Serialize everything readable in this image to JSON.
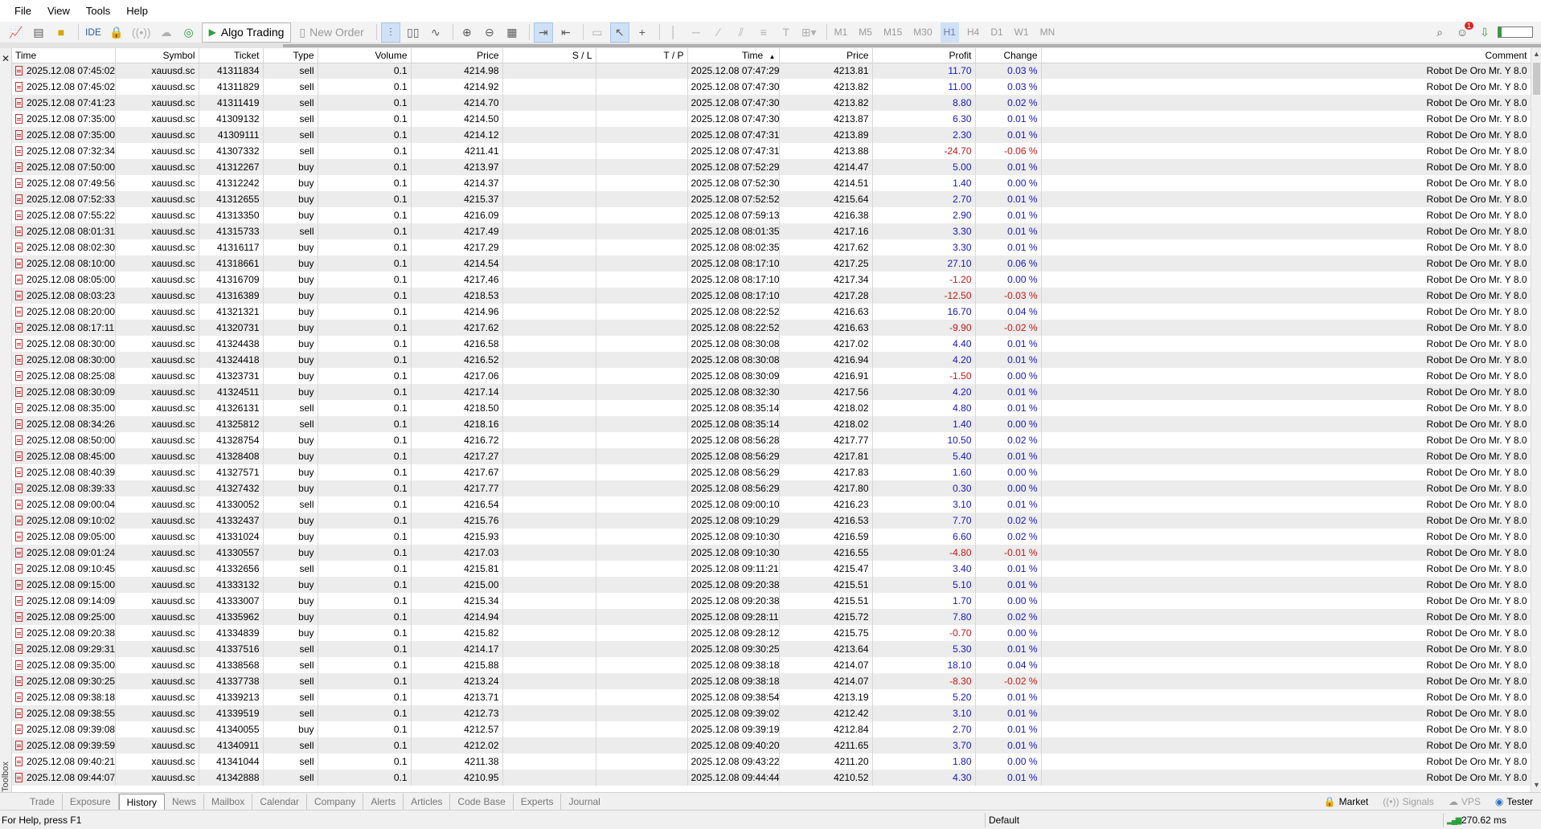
{
  "menu": [
    "File",
    "View",
    "Tools",
    "Help"
  ],
  "toolbar": {
    "ide_label": "IDE",
    "algo_label": "Algo Trading",
    "new_order_label": "New Order",
    "timeframes": [
      "M1",
      "M5",
      "M15",
      "M30",
      "H1",
      "H4",
      "D1",
      "W1",
      "MN"
    ],
    "active_timeframe": "H1",
    "notification_count": "1"
  },
  "table": {
    "columns": [
      "Time",
      "Symbol",
      "Ticket",
      "Type",
      "Volume",
      "Price",
      "S / L",
      "T / P",
      "Time",
      "Price",
      "Profit",
      "Change",
      "Comment"
    ],
    "sort_indicator": "▲",
    "rows": [
      [
        "2025.12.08 07:45:02",
        "xauusd.sc",
        "41311834",
        "sell",
        "0.1",
        "4214.98",
        "",
        "",
        "2025.12.08 07:47:29",
        "4213.81",
        "11.70",
        "0.03 %",
        "Robot De Oro Mr. Y 8.0"
      ],
      [
        "2025.12.08 07:45:02",
        "xauusd.sc",
        "41311829",
        "sell",
        "0.1",
        "4214.92",
        "",
        "",
        "2025.12.08 07:47:30",
        "4213.82",
        "11.00",
        "0.03 %",
        "Robot De Oro Mr. Y 8.0"
      ],
      [
        "2025.12.08 07:41:23",
        "xauusd.sc",
        "41311419",
        "sell",
        "0.1",
        "4214.70",
        "",
        "",
        "2025.12.08 07:47:30",
        "4213.82",
        "8.80",
        "0.02 %",
        "Robot De Oro Mr. Y 8.0"
      ],
      [
        "2025.12.08 07:35:00",
        "xauusd.sc",
        "41309132",
        "sell",
        "0.1",
        "4214.50",
        "",
        "",
        "2025.12.08 07:47:30",
        "4213.87",
        "6.30",
        "0.01 %",
        "Robot De Oro Mr. Y 8.0"
      ],
      [
        "2025.12.08 07:35:00",
        "xauusd.sc",
        "41309111",
        "sell",
        "0.1",
        "4214.12",
        "",
        "",
        "2025.12.08 07:47:31",
        "4213.89",
        "2.30",
        "0.01 %",
        "Robot De Oro Mr. Y 8.0"
      ],
      [
        "2025.12.08 07:32:34",
        "xauusd.sc",
        "41307332",
        "sell",
        "0.1",
        "4211.41",
        "",
        "",
        "2025.12.08 07:47:31",
        "4213.88",
        "-24.70",
        "-0.06 %",
        "Robot De Oro Mr. Y 8.0"
      ],
      [
        "2025.12.08 07:50:00",
        "xauusd.sc",
        "41312267",
        "buy",
        "0.1",
        "4213.97",
        "",
        "",
        "2025.12.08 07:52:29",
        "4214.47",
        "5.00",
        "0.01 %",
        "Robot De Oro Mr. Y 8.0"
      ],
      [
        "2025.12.08 07:49:56",
        "xauusd.sc",
        "41312242",
        "buy",
        "0.1",
        "4214.37",
        "",
        "",
        "2025.12.08 07:52:30",
        "4214.51",
        "1.40",
        "0.00 %",
        "Robot De Oro Mr. Y 8.0"
      ],
      [
        "2025.12.08 07:52:33",
        "xauusd.sc",
        "41312655",
        "buy",
        "0.1",
        "4215.37",
        "",
        "",
        "2025.12.08 07:52:52",
        "4215.64",
        "2.70",
        "0.01 %",
        "Robot De Oro Mr. Y 8.0"
      ],
      [
        "2025.12.08 07:55:22",
        "xauusd.sc",
        "41313350",
        "buy",
        "0.1",
        "4216.09",
        "",
        "",
        "2025.12.08 07:59:13",
        "4216.38",
        "2.90",
        "0.01 %",
        "Robot De Oro Mr. Y 8.0"
      ],
      [
        "2025.12.08 08:01:31",
        "xauusd.sc",
        "41315733",
        "sell",
        "0.1",
        "4217.49",
        "",
        "",
        "2025.12.08 08:01:35",
        "4217.16",
        "3.30",
        "0.01 %",
        "Robot De Oro Mr. Y 8.0"
      ],
      [
        "2025.12.08 08:02:30",
        "xauusd.sc",
        "41316117",
        "buy",
        "0.1",
        "4217.29",
        "",
        "",
        "2025.12.08 08:02:35",
        "4217.62",
        "3.30",
        "0.01 %",
        "Robot De Oro Mr. Y 8.0"
      ],
      [
        "2025.12.08 08:10:00",
        "xauusd.sc",
        "41318661",
        "buy",
        "0.1",
        "4214.54",
        "",
        "",
        "2025.12.08 08:17:10",
        "4217.25",
        "27.10",
        "0.06 %",
        "Robot De Oro Mr. Y 8.0"
      ],
      [
        "2025.12.08 08:05:00",
        "xauusd.sc",
        "41316709",
        "buy",
        "0.1",
        "4217.46",
        "",
        "",
        "2025.12.08 08:17:10",
        "4217.34",
        "-1.20",
        "0.00 %",
        "Robot De Oro Mr. Y 8.0"
      ],
      [
        "2025.12.08 08:03:23",
        "xauusd.sc",
        "41316389",
        "buy",
        "0.1",
        "4218.53",
        "",
        "",
        "2025.12.08 08:17:10",
        "4217.28",
        "-12.50",
        "-0.03 %",
        "Robot De Oro Mr. Y 8.0"
      ],
      [
        "2025.12.08 08:20:00",
        "xauusd.sc",
        "41321321",
        "buy",
        "0.1",
        "4214.96",
        "",
        "",
        "2025.12.08 08:22:52",
        "4216.63",
        "16.70",
        "0.04 %",
        "Robot De Oro Mr. Y 8.0"
      ],
      [
        "2025.12.08 08:17:11",
        "xauusd.sc",
        "41320731",
        "buy",
        "0.1",
        "4217.62",
        "",
        "",
        "2025.12.08 08:22:52",
        "4216.63",
        "-9.90",
        "-0.02 %",
        "Robot De Oro Mr. Y 8.0"
      ],
      [
        "2025.12.08 08:30:00",
        "xauusd.sc",
        "41324438",
        "buy",
        "0.1",
        "4216.58",
        "",
        "",
        "2025.12.08 08:30:08",
        "4217.02",
        "4.40",
        "0.01 %",
        "Robot De Oro Mr. Y 8.0"
      ],
      [
        "2025.12.08 08:30:00",
        "xauusd.sc",
        "41324418",
        "buy",
        "0.1",
        "4216.52",
        "",
        "",
        "2025.12.08 08:30:08",
        "4216.94",
        "4.20",
        "0.01 %",
        "Robot De Oro Mr. Y 8.0"
      ],
      [
        "2025.12.08 08:25:08",
        "xauusd.sc",
        "41323731",
        "buy",
        "0.1",
        "4217.06",
        "",
        "",
        "2025.12.08 08:30:09",
        "4216.91",
        "-1.50",
        "0.00 %",
        "Robot De Oro Mr. Y 8.0"
      ],
      [
        "2025.12.08 08:30:09",
        "xauusd.sc",
        "41324511",
        "buy",
        "0.1",
        "4217.14",
        "",
        "",
        "2025.12.08 08:32:30",
        "4217.56",
        "4.20",
        "0.01 %",
        "Robot De Oro Mr. Y 8.0"
      ],
      [
        "2025.12.08 08:35:00",
        "xauusd.sc",
        "41326131",
        "sell",
        "0.1",
        "4218.50",
        "",
        "",
        "2025.12.08 08:35:14",
        "4218.02",
        "4.80",
        "0.01 %",
        "Robot De Oro Mr. Y 8.0"
      ],
      [
        "2025.12.08 08:34:26",
        "xauusd.sc",
        "41325812",
        "sell",
        "0.1",
        "4218.16",
        "",
        "",
        "2025.12.08 08:35:14",
        "4218.02",
        "1.40",
        "0.00 %",
        "Robot De Oro Mr. Y 8.0"
      ],
      [
        "2025.12.08 08:50:00",
        "xauusd.sc",
        "41328754",
        "buy",
        "0.1",
        "4216.72",
        "",
        "",
        "2025.12.08 08:56:28",
        "4217.77",
        "10.50",
        "0.02 %",
        "Robot De Oro Mr. Y 8.0"
      ],
      [
        "2025.12.08 08:45:00",
        "xauusd.sc",
        "41328408",
        "buy",
        "0.1",
        "4217.27",
        "",
        "",
        "2025.12.08 08:56:29",
        "4217.81",
        "5.40",
        "0.01 %",
        "Robot De Oro Mr. Y 8.0"
      ],
      [
        "2025.12.08 08:40:39",
        "xauusd.sc",
        "41327571",
        "buy",
        "0.1",
        "4217.67",
        "",
        "",
        "2025.12.08 08:56:29",
        "4217.83",
        "1.60",
        "0.00 %",
        "Robot De Oro Mr. Y 8.0"
      ],
      [
        "2025.12.08 08:39:33",
        "xauusd.sc",
        "41327432",
        "buy",
        "0.1",
        "4217.77",
        "",
        "",
        "2025.12.08 08:56:29",
        "4217.80",
        "0.30",
        "0.00 %",
        "Robot De Oro Mr. Y 8.0"
      ],
      [
        "2025.12.08 09:00:04",
        "xauusd.sc",
        "41330052",
        "sell",
        "0.1",
        "4216.54",
        "",
        "",
        "2025.12.08 09:00:10",
        "4216.23",
        "3.10",
        "0.01 %",
        "Robot De Oro Mr. Y 8.0"
      ],
      [
        "2025.12.08 09:10:02",
        "xauusd.sc",
        "41332437",
        "buy",
        "0.1",
        "4215.76",
        "",
        "",
        "2025.12.08 09:10:29",
        "4216.53",
        "7.70",
        "0.02 %",
        "Robot De Oro Mr. Y 8.0"
      ],
      [
        "2025.12.08 09:05:00",
        "xauusd.sc",
        "41331024",
        "buy",
        "0.1",
        "4215.93",
        "",
        "",
        "2025.12.08 09:10:30",
        "4216.59",
        "6.60",
        "0.02 %",
        "Robot De Oro Mr. Y 8.0"
      ],
      [
        "2025.12.08 09:01:24",
        "xauusd.sc",
        "41330557",
        "buy",
        "0.1",
        "4217.03",
        "",
        "",
        "2025.12.08 09:10:30",
        "4216.55",
        "-4.80",
        "-0.01 %",
        "Robot De Oro Mr. Y 8.0"
      ],
      [
        "2025.12.08 09:10:45",
        "xauusd.sc",
        "41332656",
        "sell",
        "0.1",
        "4215.81",
        "",
        "",
        "2025.12.08 09:11:21",
        "4215.47",
        "3.40",
        "0.01 %",
        "Robot De Oro Mr. Y 8.0"
      ],
      [
        "2025.12.08 09:15:00",
        "xauusd.sc",
        "41333132",
        "buy",
        "0.1",
        "4215.00",
        "",
        "",
        "2025.12.08 09:20:38",
        "4215.51",
        "5.10",
        "0.01 %",
        "Robot De Oro Mr. Y 8.0"
      ],
      [
        "2025.12.08 09:14:09",
        "xauusd.sc",
        "41333007",
        "buy",
        "0.1",
        "4215.34",
        "",
        "",
        "2025.12.08 09:20:38",
        "4215.51",
        "1.70",
        "0.00 %",
        "Robot De Oro Mr. Y 8.0"
      ],
      [
        "2025.12.08 09:25:00",
        "xauusd.sc",
        "41335962",
        "buy",
        "0.1",
        "4214.94",
        "",
        "",
        "2025.12.08 09:28:11",
        "4215.72",
        "7.80",
        "0.02 %",
        "Robot De Oro Mr. Y 8.0"
      ],
      [
        "2025.12.08 09:20:38",
        "xauusd.sc",
        "41334839",
        "buy",
        "0.1",
        "4215.82",
        "",
        "",
        "2025.12.08 09:28:12",
        "4215.75",
        "-0.70",
        "0.00 %",
        "Robot De Oro Mr. Y 8.0"
      ],
      [
        "2025.12.08 09:29:31",
        "xauusd.sc",
        "41337516",
        "sell",
        "0.1",
        "4214.17",
        "",
        "",
        "2025.12.08 09:30:25",
        "4213.64",
        "5.30",
        "0.01 %",
        "Robot De Oro Mr. Y 8.0"
      ],
      [
        "2025.12.08 09:35:00",
        "xauusd.sc",
        "41338568",
        "sell",
        "0.1",
        "4215.88",
        "",
        "",
        "2025.12.08 09:38:18",
        "4214.07",
        "18.10",
        "0.04 %",
        "Robot De Oro Mr. Y 8.0"
      ],
      [
        "2025.12.08 09:30:25",
        "xauusd.sc",
        "41337738",
        "sell",
        "0.1",
        "4213.24",
        "",
        "",
        "2025.12.08 09:38:18",
        "4214.07",
        "-8.30",
        "-0.02 %",
        "Robot De Oro Mr. Y 8.0"
      ],
      [
        "2025.12.08 09:38:18",
        "xauusd.sc",
        "41339213",
        "sell",
        "0.1",
        "4213.71",
        "",
        "",
        "2025.12.08 09:38:54",
        "4213.19",
        "5.20",
        "0.01 %",
        "Robot De Oro Mr. Y 8.0"
      ],
      [
        "2025.12.08 09:38:55",
        "xauusd.sc",
        "41339519",
        "sell",
        "0.1",
        "4212.73",
        "",
        "",
        "2025.12.08 09:39:02",
        "4212.42",
        "3.10",
        "0.01 %",
        "Robot De Oro Mr. Y 8.0"
      ],
      [
        "2025.12.08 09:39:08",
        "xauusd.sc",
        "41340055",
        "buy",
        "0.1",
        "4212.57",
        "",
        "",
        "2025.12.08 09:39:19",
        "4212.84",
        "2.70",
        "0.01 %",
        "Robot De Oro Mr. Y 8.0"
      ],
      [
        "2025.12.08 09:39:59",
        "xauusd.sc",
        "41340911",
        "sell",
        "0.1",
        "4212.02",
        "",
        "",
        "2025.12.08 09:40:20",
        "4211.65",
        "3.70",
        "0.01 %",
        "Robot De Oro Mr. Y 8.0"
      ],
      [
        "2025.12.08 09:40:21",
        "xauusd.sc",
        "41341044",
        "sell",
        "0.1",
        "4211.38",
        "",
        "",
        "2025.12.08 09:43:22",
        "4211.20",
        "1.80",
        "0.00 %",
        "Robot De Oro Mr. Y 8.0"
      ],
      [
        "2025.12.08 09:44:07",
        "xauusd.sc",
        "41342888",
        "sell",
        "0.1",
        "4210.95",
        "",
        "",
        "2025.12.08 09:44:44",
        "4210.52",
        "4.30",
        "0.01 %",
        "Robot De Oro Mr. Y 8.0"
      ]
    ]
  },
  "side_label": "Toolbox",
  "bottom_tabs": [
    "Trade",
    "Exposure",
    "History",
    "News",
    "Mailbox",
    "Calendar",
    "Company",
    "Alerts",
    "Articles",
    "Code Base",
    "Experts",
    "Journal"
  ],
  "active_tab": "History",
  "right_tabs": [
    "Market",
    "Signals",
    "VPS",
    "Tester"
  ],
  "status": {
    "help": "For Help, press F1",
    "profile": "Default",
    "ping": "270.62 ms"
  },
  "colors": {
    "profit_positive": "#1515c8",
    "profit_negative": "#cc1515",
    "row_alt": "#ececec",
    "toolbar_bg": "#f3f3f3",
    "selected_tf": "#cfe1f6"
  }
}
